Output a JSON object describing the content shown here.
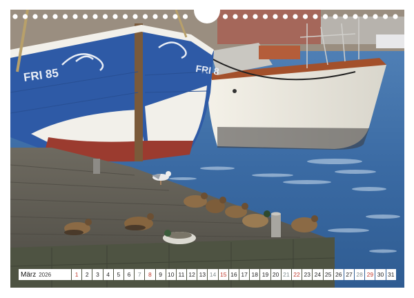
{
  "calendar": {
    "month": "März",
    "year": "2026",
    "days": [
      {
        "n": "1",
        "k": "sun"
      },
      {
        "n": "2",
        "k": ""
      },
      {
        "n": "3",
        "k": ""
      },
      {
        "n": "4",
        "k": ""
      },
      {
        "n": "5",
        "k": ""
      },
      {
        "n": "6",
        "k": ""
      },
      {
        "n": "7",
        "k": "sat"
      },
      {
        "n": "8",
        "k": "sun"
      },
      {
        "n": "9",
        "k": ""
      },
      {
        "n": "10",
        "k": ""
      },
      {
        "n": "11",
        "k": ""
      },
      {
        "n": "12",
        "k": ""
      },
      {
        "n": "13",
        "k": ""
      },
      {
        "n": "14",
        "k": "sat"
      },
      {
        "n": "15",
        "k": "sun"
      },
      {
        "n": "16",
        "k": ""
      },
      {
        "n": "17",
        "k": ""
      },
      {
        "n": "18",
        "k": ""
      },
      {
        "n": "19",
        "k": ""
      },
      {
        "n": "20",
        "k": ""
      },
      {
        "n": "21",
        "k": "sat"
      },
      {
        "n": "22",
        "k": "sun"
      },
      {
        "n": "23",
        "k": ""
      },
      {
        "n": "24",
        "k": ""
      },
      {
        "n": "25",
        "k": ""
      },
      {
        "n": "26",
        "k": ""
      },
      {
        "n": "27",
        "k": ""
      },
      {
        "n": "28",
        "k": "sat"
      },
      {
        "n": "29",
        "k": "sun"
      },
      {
        "n": "30",
        "k": ""
      },
      {
        "n": "31",
        "k": ""
      }
    ]
  },
  "photo": {
    "boat_left_registration": "FRI 85",
    "boat_left_bow_text": "FRI 8"
  },
  "colors": {
    "water": "#3b6fa8",
    "boat_blue": "#2e5aa6",
    "boat_white": "#f2f0ea",
    "pier": "#5a574f",
    "sunday": "#c0392b"
  }
}
